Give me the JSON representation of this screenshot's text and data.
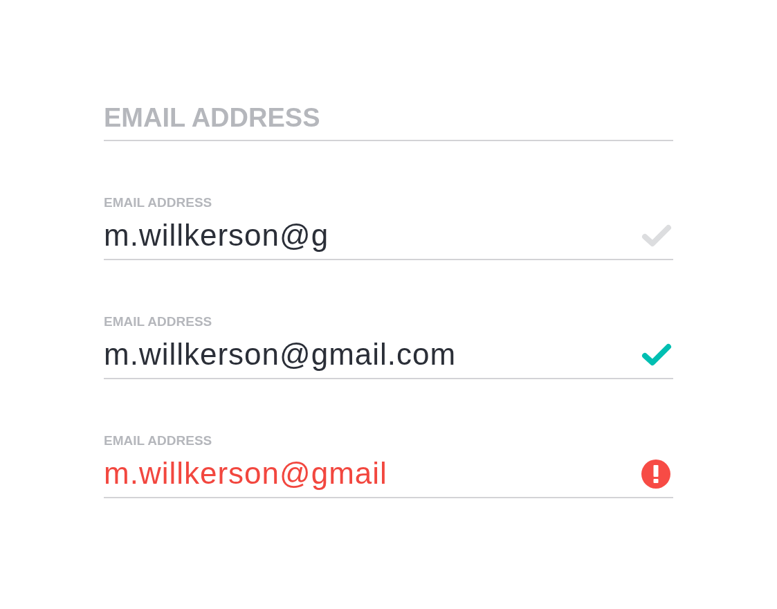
{
  "fields": [
    {
      "placeholder": "EMAIL ADDRESS"
    },
    {
      "label": "EMAIL ADDRESS",
      "value": "m.willkerson@g",
      "valid": false,
      "error": false
    },
    {
      "label": "EMAIL ADDRESS",
      "value": "m.willkerson@gmail.com",
      "valid": true,
      "error": false
    },
    {
      "label": "EMAIL ADDRESS",
      "value": "m.willkerson@gmail",
      "error": true
    }
  ]
}
